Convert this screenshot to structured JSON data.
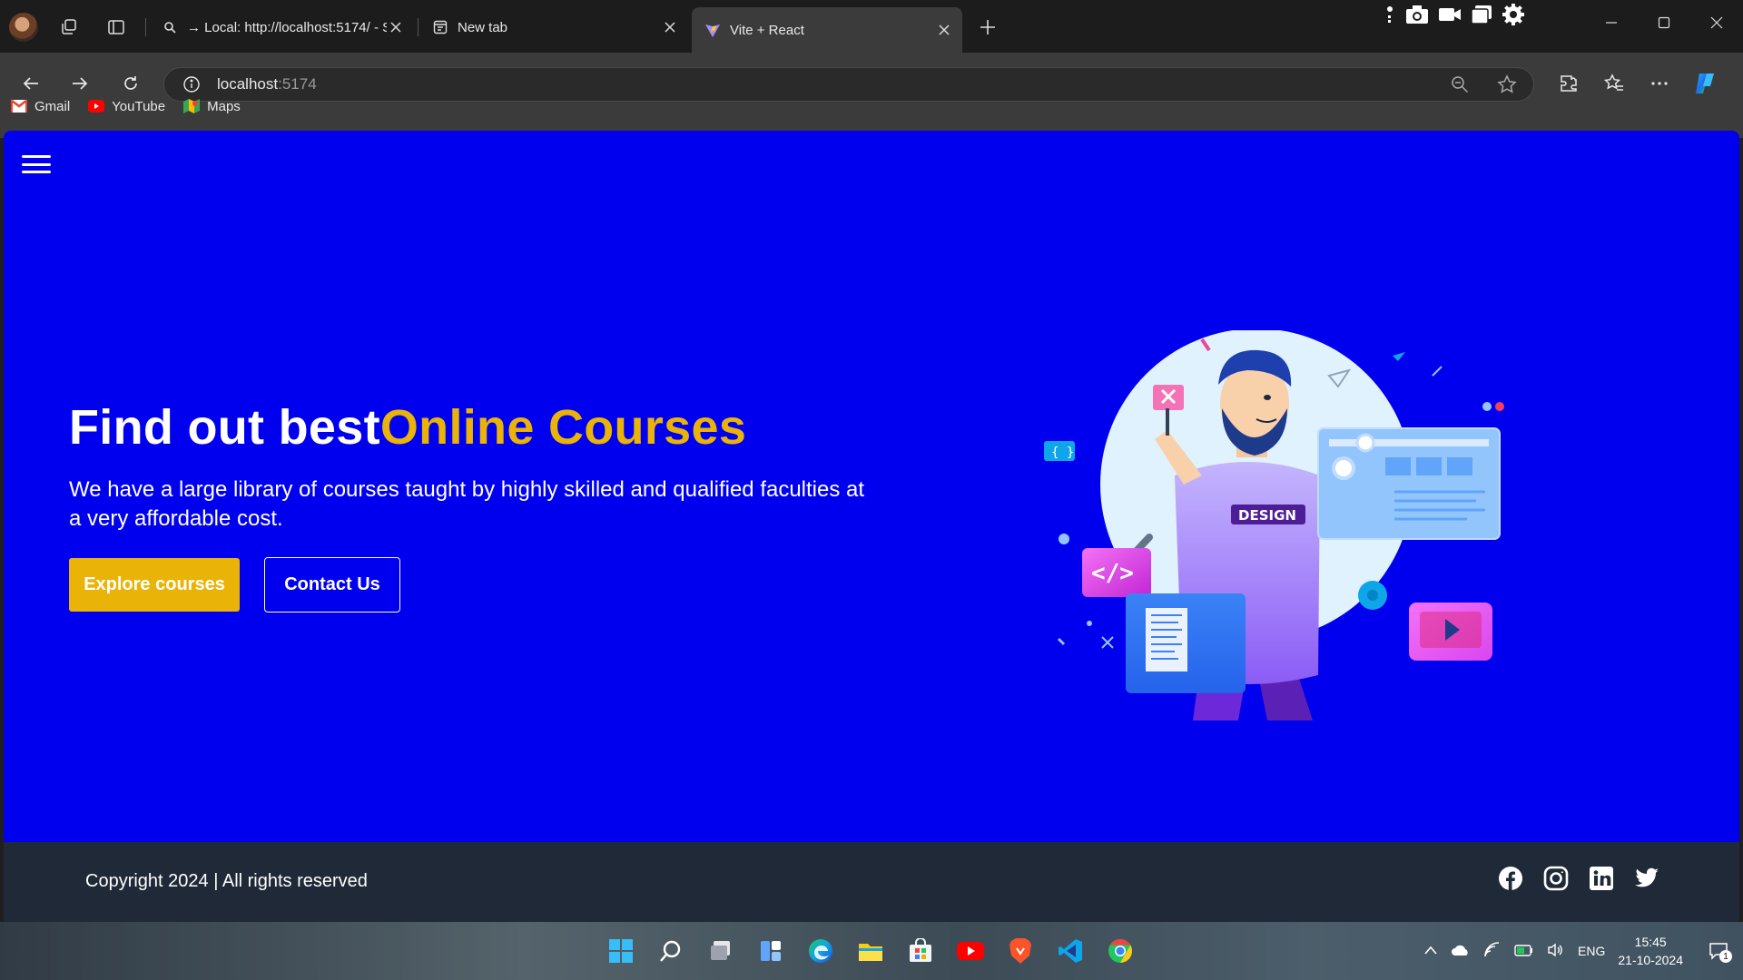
{
  "browser": {
    "tabs": [
      {
        "title": "→ Local: http://localhost:5174/ - S",
        "icon": "search-icon",
        "active": false
      },
      {
        "title": "New tab",
        "icon": "newtab-page-icon",
        "active": false
      },
      {
        "title": "Vite + React",
        "icon": "vite-logo-icon",
        "active": true
      }
    ],
    "address": {
      "host": "localhost",
      "port": ":5174"
    },
    "bookmarks": [
      {
        "label": "Gmail",
        "icon": "gmail-icon"
      },
      {
        "label": "YouTube",
        "icon": "youtube-icon"
      },
      {
        "label": "Maps",
        "icon": "maps-icon"
      }
    ]
  },
  "page": {
    "hero": {
      "title_plain": "Find out best",
      "title_accent": "Online Courses",
      "description": "We have a large library of courses taught by highly skilled and qualified faculties at a very affordable cost.",
      "explore_label": "Explore courses",
      "contact_label": "Contact Us",
      "illustration_badge": "DESIGN"
    },
    "footer": {
      "copyright": "Copyright 2024 | All rights reserved",
      "socials": [
        "facebook-icon",
        "instagram-icon",
        "linkedin-icon",
        "twitter-icon"
      ]
    },
    "colors": {
      "background": "#0000ef",
      "accent": "#eab308",
      "footer": "#1f2937"
    }
  },
  "taskbar": {
    "apps": [
      "windows-start-icon",
      "search-icon",
      "task-view-icon",
      "widgets-icon",
      "edge-icon",
      "file-explorer-icon",
      "store-icon",
      "youtube-icon",
      "brave-icon",
      "vscode-icon",
      "chrome-icon"
    ],
    "tray": {
      "language": "ENG",
      "time": "15:45",
      "date": "21-10-2024",
      "notifications": "1"
    }
  }
}
